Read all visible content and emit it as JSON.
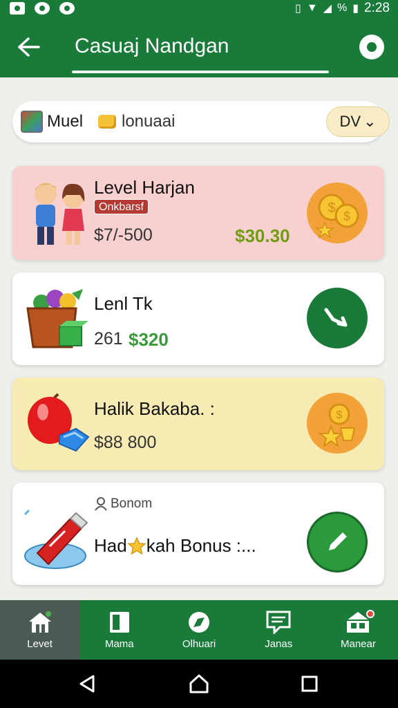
{
  "status_bar": {
    "time": "2:28",
    "battery_label": "%"
  },
  "app_bar": {
    "title": "Casuaj Nandgan"
  },
  "filter": {
    "name": "Muel",
    "text": "lonuaai",
    "dropdown_value": "DV",
    "dropdown_chevron": "⌄"
  },
  "cards": [
    {
      "title": "Level Harjan",
      "badge": "Onkbarsf",
      "price": "$7/-500",
      "reward": "$30.30",
      "icon": "couple-icon",
      "action_icon": "coins-icon"
    },
    {
      "title": "Lenl Tk",
      "price": "261",
      "reward": "$320",
      "icon": "basket-icon",
      "action_icon": "phone-icon"
    },
    {
      "title": "Halik Bakaba. :",
      "price": "$88 800",
      "icon": "apple-gem-icon",
      "action_icon": "coin-star-icon"
    },
    {
      "subtitle": "Bonom",
      "title_prefix": "Had",
      "title_suffix": "kah Bonus :...",
      "icon": "bottle-icon",
      "action_icon": "edit-icon"
    }
  ],
  "bottom_nav": [
    {
      "label": "Levet",
      "icon": "home-icon",
      "active": true
    },
    {
      "label": "Mama",
      "icon": "book-icon",
      "active": false
    },
    {
      "label": "Olhuari",
      "icon": "compass-icon",
      "active": false
    },
    {
      "label": "Janas",
      "icon": "chat-icon",
      "active": false
    },
    {
      "label": "Manear",
      "icon": "store-icon",
      "active": false
    }
  ],
  "colors": {
    "primary": "#1a7a3a",
    "card_pink": "#f8d0d0",
    "card_yellow": "#f7ebb4",
    "reward_green": "#6f9e12",
    "badge_red": "#b23a32"
  }
}
